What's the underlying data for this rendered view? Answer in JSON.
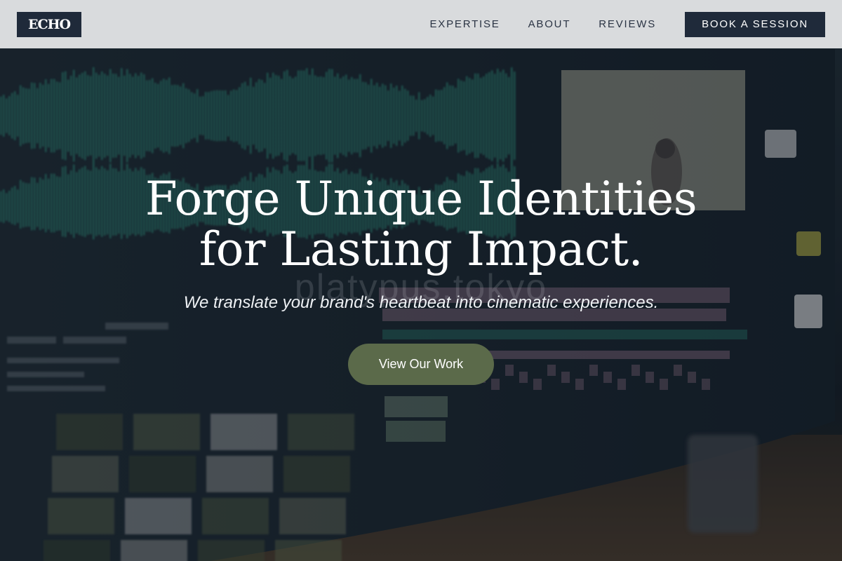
{
  "brand": {
    "logo_text": "ECHO"
  },
  "nav": {
    "links": [
      "EXPERTISE",
      "ABOUT",
      "REVIEWS"
    ],
    "cta_label": "BOOK A SESSION"
  },
  "hero": {
    "title_line1": "Forge Unique Identities",
    "title_line2": "for Lasting Impact.",
    "subtitle": "We translate your brand's heartbeat into cinematic experiences.",
    "cta_label": "View Our Work",
    "watermark": "platypus.tokyo",
    "background_icon": "video-editing-monitor-photo"
  },
  "colors": {
    "nav_bg": "#e8eaec",
    "dark_navy": "#1f2a3a",
    "cta_green": "#5b6a4a",
    "waveform_teal": "#2f8f7c",
    "timeline_pink": "#b48aa4"
  }
}
